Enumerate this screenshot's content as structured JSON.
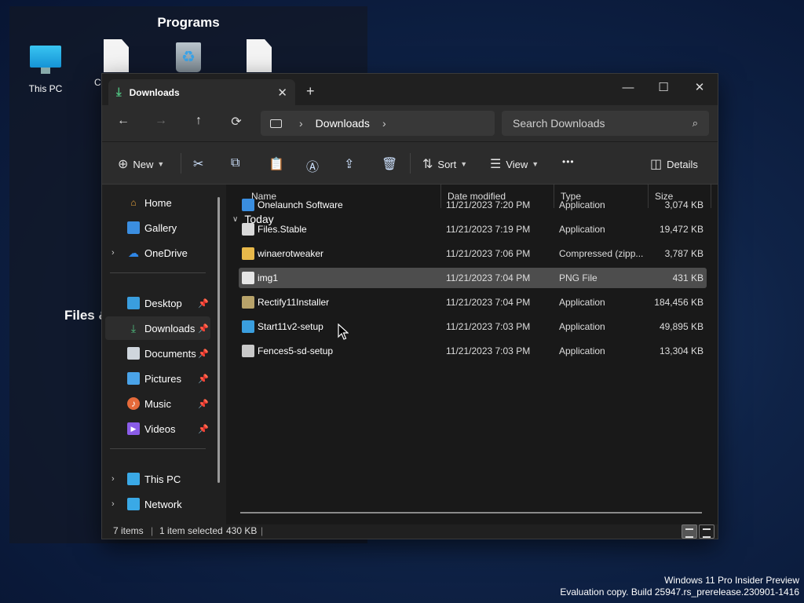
{
  "desktop": {
    "programs_title": "Programs",
    "behind_label": "Files &",
    "icons": [
      {
        "label": "This PC",
        "icon": "monitor-icon"
      },
      {
        "label": "C",
        "icon": "document-icon"
      },
      {
        "label": "",
        "icon": "recycle-bin-icon"
      },
      {
        "label": "",
        "icon": "document-icon"
      }
    ]
  },
  "watermark": {
    "line1": "Windows 11 Pro Insider Preview",
    "line2": "Evaluation copy. Build 25947.rs_prerelease.230901-1416"
  },
  "window": {
    "tab": {
      "label": "Downloads",
      "close": "✕"
    },
    "new_tab": "+",
    "controls": {
      "minimize": "—",
      "maximize": "☐",
      "close": "✕"
    },
    "nav": {
      "back": "←",
      "forward": "→",
      "up": "↑",
      "refresh": "⟳"
    },
    "breadcrumb": {
      "location": "Downloads",
      "separator": "›"
    },
    "search": {
      "placeholder": "Search Downloads"
    },
    "toolbar": {
      "new_label": "New",
      "sort_label": "Sort",
      "view_label": "View",
      "more_label": "•••",
      "details_label": "Details"
    },
    "navpane": {
      "top": [
        {
          "label": "Home",
          "icon": "home-icon",
          "color": "#e8a33c"
        },
        {
          "label": "Gallery",
          "icon": "gallery-icon",
          "color": "#3b8ee0"
        },
        {
          "label": "OneDrive",
          "icon": "cloud-icon",
          "color": "#2f86e6",
          "expandable": true
        }
      ],
      "pinned": [
        {
          "label": "Desktop",
          "icon": "desktop-icon",
          "color": "#3a9ede"
        },
        {
          "label": "Downloads",
          "icon": "download-icon",
          "color": "#4fc080",
          "selected": true
        },
        {
          "label": "Documents",
          "icon": "documents-icon",
          "color": "#cfd6dd"
        },
        {
          "label": "Pictures",
          "icon": "pictures-icon",
          "color": "#4aa3e8"
        },
        {
          "label": "Music",
          "icon": "music-icon",
          "color": "#e56a3a"
        },
        {
          "label": "Videos",
          "icon": "videos-icon",
          "color": "#8a5ce8"
        }
      ],
      "bottom": [
        {
          "label": "This PC",
          "icon": "monitor-icon",
          "color": "#3aa9e6",
          "expandable": true
        },
        {
          "label": "Network",
          "icon": "network-icon",
          "color": "#3aa9e6",
          "expandable": true
        }
      ]
    },
    "columns": {
      "name": "Name",
      "date": "Date modified",
      "type": "Type",
      "size": "Size"
    },
    "group": "Today",
    "files": [
      {
        "name": "Onelaunch Software",
        "date": "11/21/2023 7:20 PM",
        "type": "Application",
        "size": "3,074 KB",
        "icon": "onelaunch-icon",
        "color": "#3a8ee0"
      },
      {
        "name": "Files.Stable",
        "date": "11/21/2023 7:19 PM",
        "type": "Application",
        "size": "19,472 KB",
        "icon": "app-icon",
        "color": "#d9d9d9"
      },
      {
        "name": "winaerotweaker",
        "date": "11/21/2023 7:06 PM",
        "type": "Compressed (zipp...",
        "size": "3,787 KB",
        "icon": "zip-folder-icon",
        "color": "#e8b94a"
      },
      {
        "name": "img1",
        "date": "11/21/2023 7:04 PM",
        "type": "PNG File",
        "size": "431 KB",
        "icon": "image-file-icon",
        "color": "#e6e6e6",
        "selected": true
      },
      {
        "name": "Rectify11Installer",
        "date": "11/21/2023 7:04 PM",
        "type": "Application",
        "size": "184,456 KB",
        "icon": "installer-icon",
        "color": "#b8a36a"
      },
      {
        "name": "Start11v2-setup",
        "date": "11/21/2023 7:03 PM",
        "type": "Application",
        "size": "49,895 KB",
        "icon": "setup-icon",
        "color": "#3a9ede"
      },
      {
        "name": "Fences5-sd-setup",
        "date": "11/21/2023 7:03 PM",
        "type": "Application",
        "size": "13,304 KB",
        "icon": "setup-icon",
        "color": "#c9c9c9"
      }
    ],
    "status": {
      "items": "7 items",
      "selected": "1 item selected",
      "size": "430 KB",
      "sep": "|"
    }
  }
}
